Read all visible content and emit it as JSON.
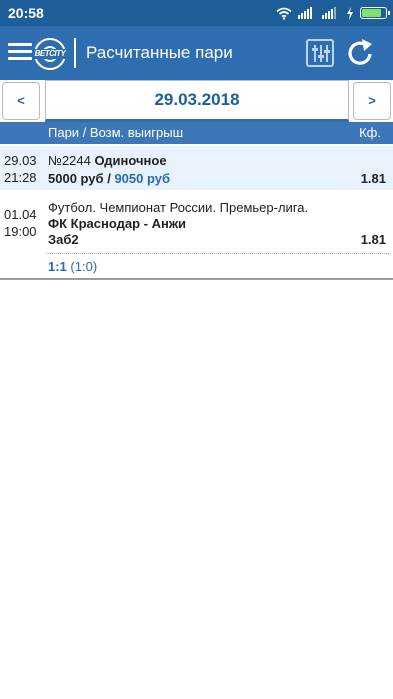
{
  "status_bar": {
    "time": "20:58",
    "icons": [
      "wifi-icon",
      "signal-icon",
      "signal-icon",
      "charging-icon",
      "battery-icon"
    ],
    "battery_level": 0.85,
    "battery_color": "#7ee36a"
  },
  "app_bar": {
    "title": "Расчитанные пари",
    "logo_text": "BETCITY",
    "icons": [
      "menu-icon",
      "filter-icon",
      "refresh-icon"
    ],
    "color": "#2f6db1"
  },
  "date_nav": {
    "prev_label": "<",
    "date": "29.03.2018",
    "next_label": ">"
  },
  "table_header": {
    "col_bet": "Пари / Возм. выигрыш",
    "col_coef": "Кф."
  },
  "bet": {
    "date": "29.03",
    "time": "21:28",
    "number": "№2244",
    "type": "Одиночное",
    "stake": "5000 руб",
    "separator": "/",
    "payout": "9050 руб",
    "coef": "1.81"
  },
  "event": {
    "date": "01.04",
    "time": "19:00",
    "league": "Футбол. Чемпионат России. Премьер-лига.",
    "teams": "ФК Краснодар - Анжи",
    "outcome": "Заб2",
    "coef": "1.81",
    "score": "1:1",
    "halftime": "(1:0)"
  }
}
